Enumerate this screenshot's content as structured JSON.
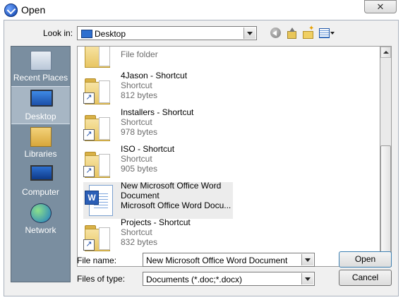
{
  "window": {
    "title": "Open",
    "close_symbol": "✕"
  },
  "lookin": {
    "label": "Look in:",
    "value": "Desktop"
  },
  "toolbar": {
    "icons": [
      "back-icon",
      "up-folder-icon",
      "new-folder-icon",
      "views-menu-icon"
    ]
  },
  "places": [
    {
      "label": "Recent Places",
      "icon": "recent-places-icon"
    },
    {
      "label": "Desktop",
      "icon": "desktop-icon",
      "selected": true
    },
    {
      "label": "Libraries",
      "icon": "libraries-icon"
    },
    {
      "label": "Computer",
      "icon": "computer-icon"
    },
    {
      "label": "Network",
      "icon": "network-icon"
    }
  ],
  "files": [
    {
      "name": "",
      "type": "File folder",
      "size": ""
    },
    {
      "name": "4Jason - Shortcut",
      "type": "Shortcut",
      "size": "812 bytes"
    },
    {
      "name": "Installers - Shortcut",
      "type": "Shortcut",
      "size": "978 bytes"
    },
    {
      "name": "ISO - Shortcut",
      "type": "Shortcut",
      "size": "905 bytes"
    },
    {
      "name": "New Microsoft Office Word",
      "name2": "Document",
      "type": "Microsoft Office Word Docu...",
      "selected": true
    },
    {
      "name": "Projects - Shortcut",
      "type": "Shortcut",
      "size": "832 bytes"
    }
  ],
  "filename": {
    "label": "File name:",
    "value": "New Microsoft Office Word Document"
  },
  "filetype": {
    "label": "Files of type:",
    "value": "Documents (*.doc;*.docx)"
  },
  "buttons": {
    "open": "Open",
    "cancel": "Cancel"
  }
}
